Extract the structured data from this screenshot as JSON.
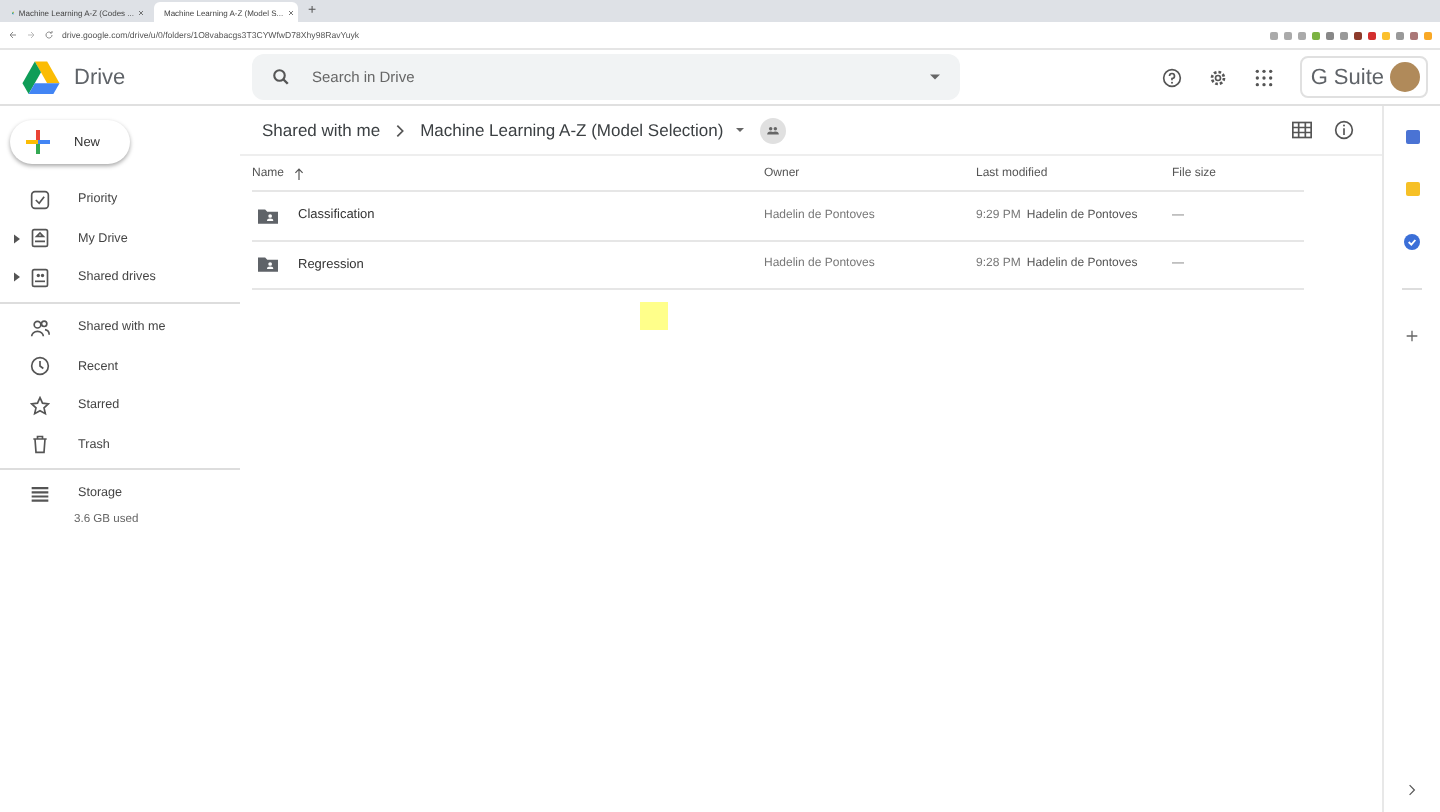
{
  "browser": {
    "tabs": [
      {
        "title": "Machine Learning A-Z (Codes ...",
        "selected": false
      },
      {
        "title": "Machine Learning A-Z (Model S...",
        "selected": true
      }
    ],
    "new_tab": "+",
    "url": "drive.google.com/drive/u/0/folders/1O8vabacgs3T3CYWfwD78Xhy98RavYuyk"
  },
  "header": {
    "logo": "Drive",
    "search": {
      "placeholder": "Search in Drive"
    },
    "gsuite": "G Suite"
  },
  "new_button": "New",
  "sidebar": {
    "groups": [
      [
        {
          "label": "Priority",
          "expandable": false
        },
        {
          "label": "My Drive",
          "expandable": true
        },
        {
          "label": "Shared drives",
          "expandable": true
        }
      ],
      [
        {
          "label": "Shared with me",
          "expandable": false
        },
        {
          "label": "Recent",
          "expandable": false
        },
        {
          "label": "Starred",
          "expandable": false
        },
        {
          "label": "Trash",
          "expandable": false
        }
      ]
    ],
    "storage": {
      "label": "Storage",
      "usage": "3.6 GB used"
    }
  },
  "breadcrumb": [
    {
      "label": "Shared with me"
    },
    {
      "label": "Machine Learning A-Z (Model Selection)"
    }
  ],
  "table": {
    "columns": [
      "Name",
      "Owner",
      "Last modified",
      "File size"
    ],
    "rows": [
      {
        "name": "Classification",
        "owner": "Hadelin de Pontoves",
        "time": "9:29 PM",
        "modified_by": "Hadelin de Pontoves",
        "size": "—"
      },
      {
        "name": "Regression",
        "owner": "Hadelin de Pontoves",
        "time": "9:28 PM",
        "modified_by": "Hadelin de Pontoves",
        "size": "—"
      }
    ]
  }
}
